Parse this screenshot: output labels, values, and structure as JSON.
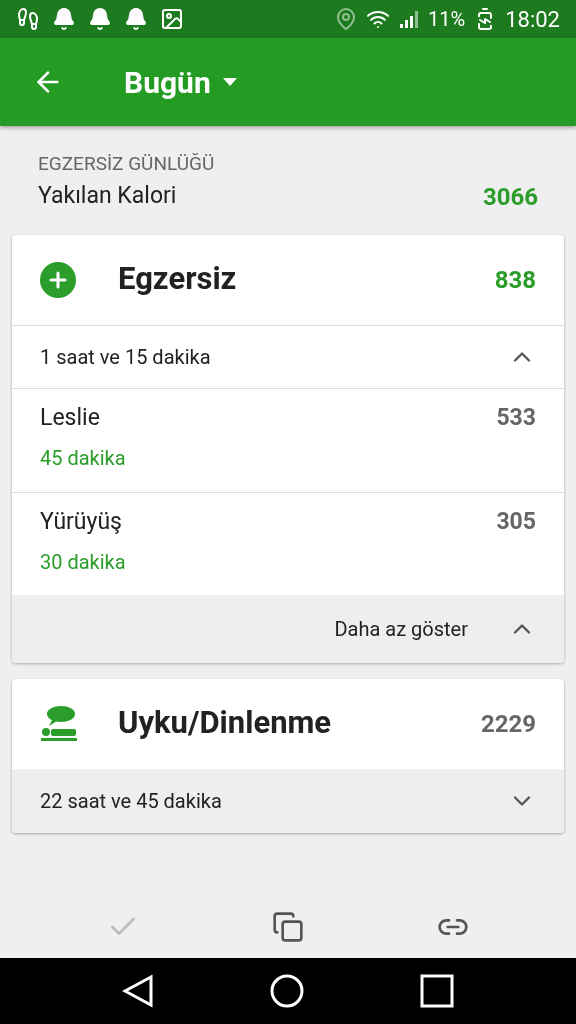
{
  "status_bar": {
    "battery": "11%",
    "time": "18:02"
  },
  "app_bar": {
    "title": "Bugün"
  },
  "summary": {
    "section": "EGZERSİZ GÜNLÜĞÜ",
    "label": "Yakılan Kalori",
    "value": "3066"
  },
  "cards": [
    {
      "kind": "exercise",
      "title": "Egzersiz",
      "total": "838",
      "duration": "1 saat ve 15 dakika",
      "expanded": true,
      "entries": [
        {
          "name": "Leslie",
          "minutes": "45 dakika",
          "calories": "533"
        },
        {
          "name": "Yürüyüş",
          "minutes": "30 dakika",
          "calories": "305"
        }
      ],
      "footer": "Daha az göster"
    },
    {
      "kind": "sleep",
      "title": "Uyku/Dinlenme",
      "total": "2229",
      "duration": "22 saat ve 45 dakika",
      "expanded": false
    }
  ],
  "actions": [
    {
      "kind": "check",
      "disabled": true
    },
    {
      "kind": "copy",
      "disabled": false
    },
    {
      "kind": "link",
      "disabled": false
    }
  ]
}
